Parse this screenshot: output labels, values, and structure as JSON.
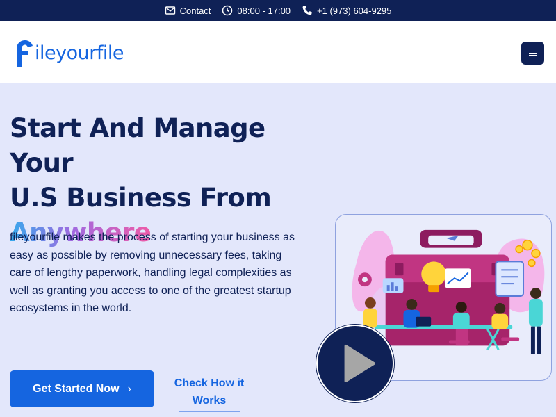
{
  "topbar": {
    "contact": "Contact",
    "hours": "08:00 - 17:00",
    "phone": "+1 (973) 604-9295"
  },
  "header": {
    "logo_text": "ileyourfile",
    "logo_letter": "f",
    "menu_icon": "hamburger-icon"
  },
  "hero": {
    "title_line1": "Start And Manage Your",
    "title_line2": "U.S Business From",
    "title_highlight": "Anywhere",
    "description": "fileyourfile makes the process of starting your business as easy as possible by removing unnecessary fees, taking care of lengthy paperwork, handling legal complexities as well as granting you access to one of the greatest startup ecosystems in the world.",
    "cta_label": "Get Started Now",
    "cta_icon": "chevron-right-icon",
    "secondary_link": "Check How it Works"
  },
  "video": {
    "play_icon": "play-icon"
  },
  "colors": {
    "navy": "#0f2156",
    "blue": "#1565e0",
    "hero_bg": "#e3e7fb"
  }
}
